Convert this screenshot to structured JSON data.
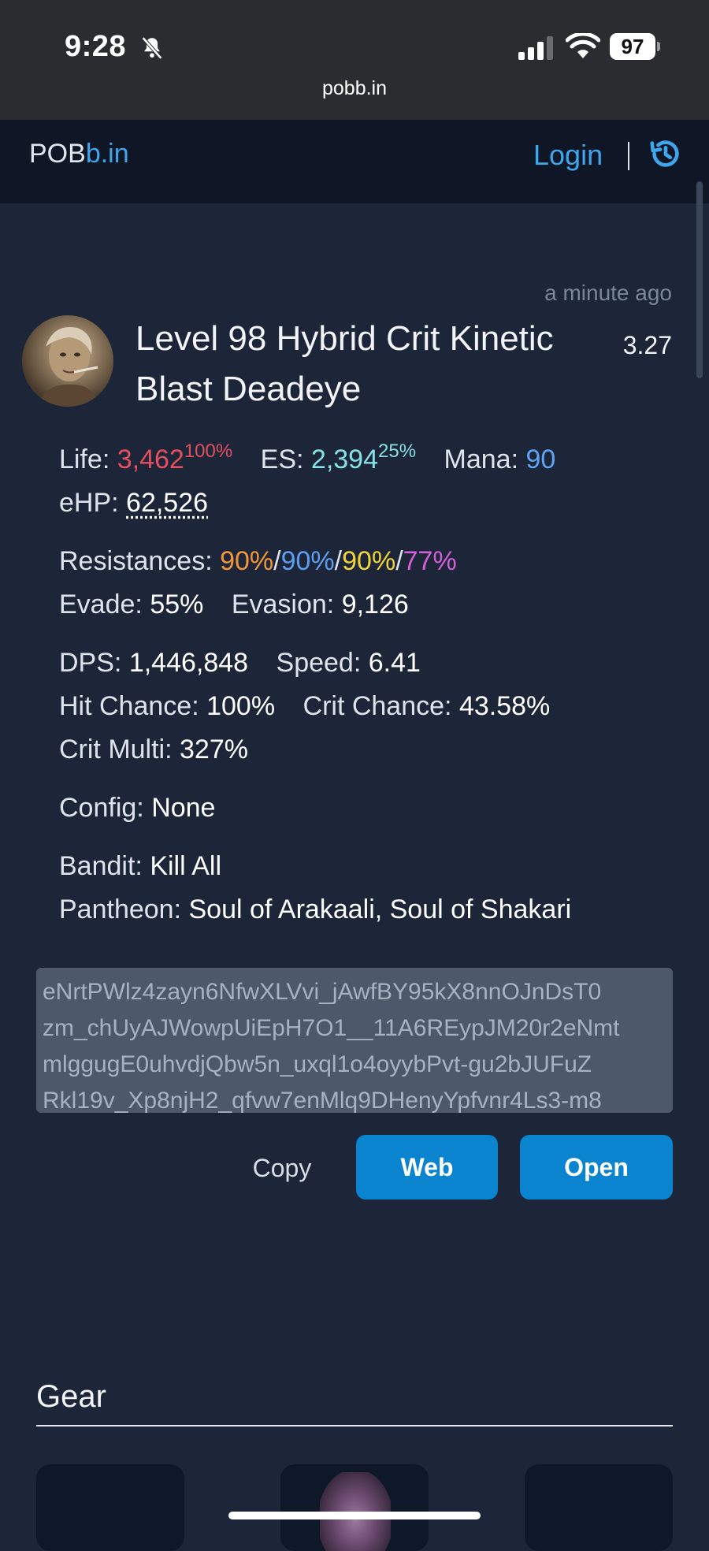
{
  "status_bar": {
    "time": "9:28",
    "battery": "97",
    "icons": [
      "bell-slash-icon",
      "signal-icon",
      "wifi-icon",
      "battery-icon"
    ]
  },
  "browser": {
    "url": "pobb.in"
  },
  "nav": {
    "logo_prefix": "POB",
    "logo_suffix": "b.in",
    "login": "Login",
    "history_icon": "history-icon",
    "accent": "#3fa6ec"
  },
  "build": {
    "time_ago": "a minute ago",
    "title": "Level 98 Hybrid Crit Kinetic Blast Deadeye",
    "version": "3.27",
    "stats": {
      "life_label": "Life:",
      "life": "3,462",
      "life_pct": "100%",
      "es_label": "ES:",
      "es": "2,394",
      "es_pct": "25%",
      "mana_label": "Mana:",
      "mana": "90",
      "ehp_label": "eHP:",
      "ehp": "62,526",
      "res_label": "Resistances:",
      "res_fire": "90%",
      "res_cold": "90%",
      "res_light": "90%",
      "res_chaos": "77%",
      "slash": "/",
      "evade_label": "Evade:",
      "evade": "55%",
      "evasion_label": "Evasion:",
      "evasion": "9,126",
      "dps_label": "DPS:",
      "dps": "1,446,848",
      "speed_label": "Speed:",
      "speed": "6.41",
      "hit_label": "Hit Chance:",
      "hit": "100%",
      "crit_chance_label": "Crit Chance:",
      "crit_chance": "43.58%",
      "crit_multi_label": "Crit Multi:",
      "crit_multi": "327%",
      "config_label": "Config:",
      "config": "None",
      "bandit_label": "Bandit:",
      "bandit": "Kill All",
      "pantheon_label": "Pantheon:",
      "pantheon": "Soul of Arakaali, Soul of Shakari"
    },
    "code_lines": [
      "eNrtPWlz4zayn6NfwXLVvi_jAwfBY95kX8nnOJnDsT0",
      "zm_chUyAJWowpUiEpH7O1__11A6REypJM20r2eNmt",
      "mlggugE0uhvdjQbw5n_uxql1o4oyybPvt-gu2bJUFuZ",
      "Rkl19v_Xp8njH2_qfvw7enMlq9DHenyYpfvnr4Ls3-m8"
    ],
    "actions": {
      "copy": "Copy",
      "web": "Web",
      "open": "Open"
    }
  },
  "gear": {
    "heading": "Gear"
  },
  "colors": {
    "life": "#e2505f",
    "es": "#86e0e6",
    "mana": "#5ea4f4",
    "fire": "#f2963a",
    "cold": "#5e9ef0",
    "lightning": "#f2d23a",
    "chaos": "#d45ed8",
    "button": "#0a84cf"
  }
}
